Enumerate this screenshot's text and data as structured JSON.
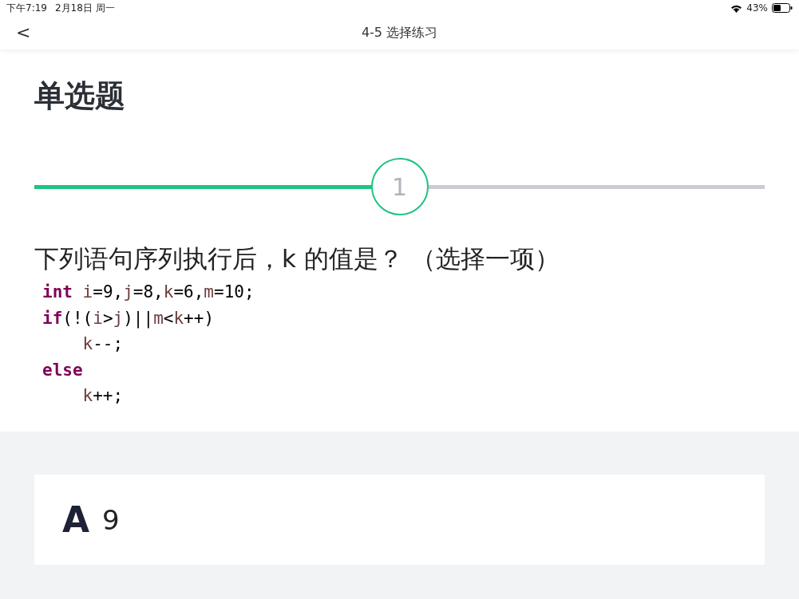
{
  "status_bar": {
    "time": "下午7:19",
    "date": "2月18日 周一",
    "battery": "43%"
  },
  "nav": {
    "back": "<",
    "title": "4-5 选择练习"
  },
  "heading": "单选题",
  "progress": {
    "level": 0.5,
    "step": "1"
  },
  "question": {
    "text": "下列语句序列执行后，k 的值是？ （选择一项）",
    "code": [
      {
        "tokens": [
          {
            "kind": "keyword",
            "text": "int "
          },
          {
            "kind": "var",
            "text": "i"
          },
          {
            "kind": "plain",
            "text": "=9,"
          },
          {
            "kind": "var",
            "text": "j"
          },
          {
            "kind": "plain",
            "text": "=8,"
          },
          {
            "kind": "var",
            "text": "k"
          },
          {
            "kind": "plain",
            "text": "=6,"
          },
          {
            "kind": "var",
            "text": "m"
          },
          {
            "kind": "plain",
            "text": "=10;"
          }
        ]
      },
      {
        "tokens": [
          {
            "kind": "keyword",
            "text": "if"
          },
          {
            "kind": "plain",
            "text": "(!("
          },
          {
            "kind": "var",
            "text": "i"
          },
          {
            "kind": "plain",
            "text": ">"
          },
          {
            "kind": "var",
            "text": "j"
          },
          {
            "kind": "plain",
            "text": ")||"
          },
          {
            "kind": "var",
            "text": "m"
          },
          {
            "kind": "plain",
            "text": "<"
          },
          {
            "kind": "var",
            "text": "k"
          },
          {
            "kind": "plain",
            "text": "++)"
          }
        ],
        "children": [
          {
            "tokens": [
              {
                "kind": "var",
                "text": "k"
              },
              {
                "kind": "plain",
                "text": "--;"
              }
            ]
          }
        ]
      },
      {
        "tokens": [
          {
            "kind": "keyword",
            "text": "else"
          }
        ],
        "children": [
          {
            "tokens": [
              {
                "kind": "var",
                "text": "k"
              },
              {
                "kind": "plain",
                "text": "++;"
              }
            ]
          }
        ]
      }
    ]
  },
  "options": [
    {
      "letter": "A",
      "text": "9",
      "selected": false
    }
  ]
}
